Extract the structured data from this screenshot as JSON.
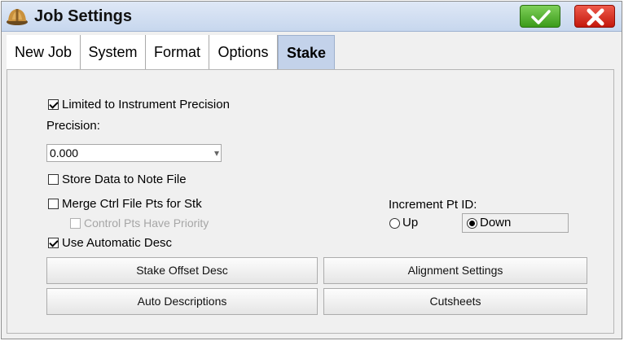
{
  "window": {
    "title": "Job Settings"
  },
  "tabs": [
    {
      "label": "New Job"
    },
    {
      "label": "System"
    },
    {
      "label": "Format"
    },
    {
      "label": "Options"
    },
    {
      "label": "Stake",
      "active": true
    }
  ],
  "stake": {
    "limited_precision": {
      "label": "Limited to Instrument Precision",
      "checked": true
    },
    "precision_label": "Precision:",
    "precision_value": "0.000",
    "store_note": {
      "label": "Store Data to Note File",
      "checked": false
    },
    "merge_ctrl": {
      "label": "Merge Ctrl File Pts for Stk",
      "checked": false
    },
    "control_priority": {
      "label": "Control Pts Have Priority",
      "checked": false,
      "disabled": true
    },
    "auto_desc": {
      "label": "Use Automatic Desc",
      "checked": true
    },
    "increment_label": "Increment Pt ID:",
    "increment_up": "Up",
    "increment_down": "Down",
    "increment_selected": "Down",
    "buttons": {
      "stake_offset": "Stake Offset Desc",
      "alignment": "Alignment Settings",
      "auto_descriptions": "Auto Descriptions",
      "cutsheets": "Cutsheets"
    }
  },
  "colors": {
    "ok": "#3b9b1a",
    "close": "#c4180c",
    "active_tab": "#c3d2ea"
  }
}
